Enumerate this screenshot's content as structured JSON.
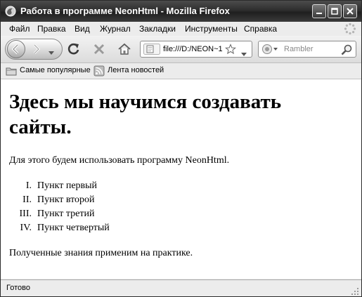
{
  "window": {
    "title": "Работа в программе NeonHtml - Mozilla Firefox"
  },
  "menu": {
    "items": [
      "Файл",
      "Правка",
      "Вид",
      "Журнал",
      "Закладки",
      "Инструменты",
      "Справка"
    ]
  },
  "navigation": {
    "url": "file:///D:/NEON~1",
    "search_placeholder": "Rambler"
  },
  "bookmarks": {
    "items": [
      "Самые популярные",
      "Лента новостей"
    ]
  },
  "page": {
    "heading": "Здесь мы научимся создавать сайты.",
    "intro": "Для этого будем использовать программу NeonHtml.",
    "list": [
      {
        "num": "I.",
        "text": "Пункт первый"
      },
      {
        "num": "II.",
        "text": "Пункт второй"
      },
      {
        "num": "III.",
        "text": "Пункт третий"
      },
      {
        "num": "IV.",
        "text": "Пункт четвертый"
      }
    ],
    "outro": "Полученные знания применим на практике."
  },
  "status": {
    "text": "Готово"
  }
}
